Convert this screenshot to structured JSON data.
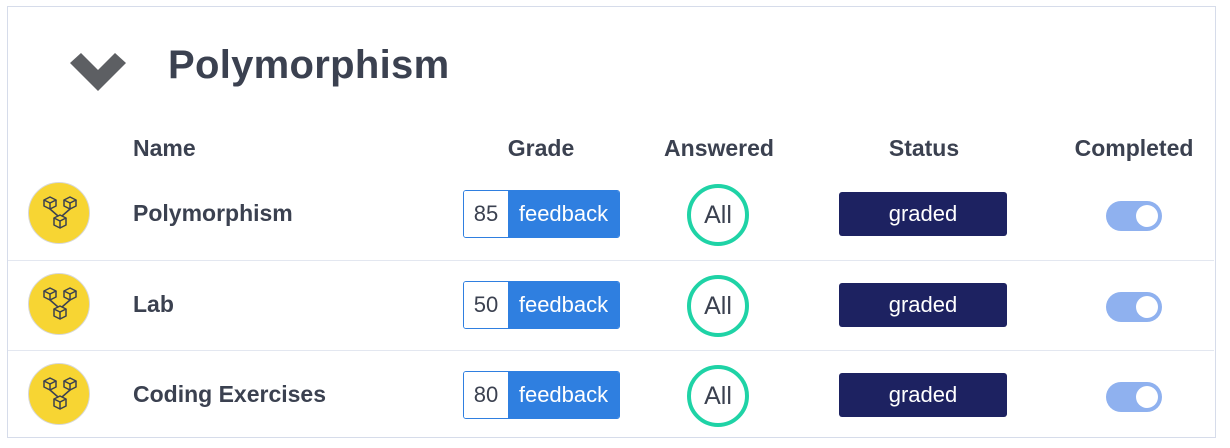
{
  "section": {
    "title": "Polymorphism",
    "collapse_icon": "chevron-down-icon"
  },
  "columns": {
    "name": "Name",
    "grade": "Grade",
    "answered": "Answered",
    "status": "Status",
    "completed": "Completed"
  },
  "rows": [
    {
      "name": "Polymorphism",
      "grade": "85",
      "feedback_label": "feedback",
      "answered": "All",
      "status": "graded",
      "completed": true,
      "icon": "module-boxes-icon"
    },
    {
      "name": "Lab",
      "grade": "50",
      "feedback_label": "feedback",
      "answered": "All",
      "status": "graded",
      "completed": true,
      "icon": "module-boxes-icon"
    },
    {
      "name": "Coding Exercises",
      "grade": "80",
      "feedback_label": "feedback",
      "answered": "All",
      "status": "graded",
      "completed": true,
      "icon": "module-boxes-icon"
    }
  ],
  "colors": {
    "feedback_blue": "#2f7fe0",
    "answered_ring": "#1fd3a6",
    "status_navy": "#1d2261",
    "toggle_on": "#8fb1ef",
    "avatar_yellow": "#f7d533"
  }
}
